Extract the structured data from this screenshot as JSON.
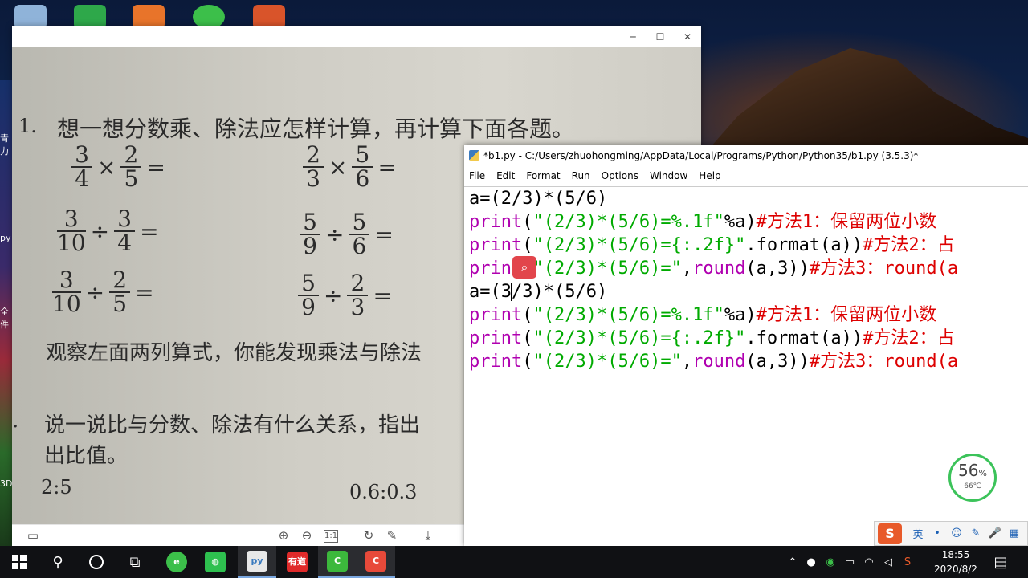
{
  "viewer": {
    "controls": {
      "minimize": "─",
      "maximize": "☐",
      "close": "✕"
    },
    "content": {
      "q1_number": "1.",
      "q1_text": "想一想分数乘、除法应怎样计算，再计算下面各题。",
      "fractions": [
        {
          "a_num": "3",
          "a_den": "4",
          "op": "×",
          "b_num": "2",
          "b_den": "5"
        },
        {
          "a_num": "2",
          "a_den": "3",
          "op": "×",
          "b_num": "5",
          "b_den": "6"
        },
        {
          "a_num": "3",
          "a_den": "10",
          "op": "÷",
          "b_num": "3",
          "b_den": "4"
        },
        {
          "a_num": "5",
          "a_den": "9",
          "op": "÷",
          "b_num": "5",
          "b_den": "6"
        },
        {
          "a_num": "3",
          "a_den": "10",
          "op": "÷",
          "b_num": "2",
          "b_den": "5"
        },
        {
          "a_num": "5",
          "a_den": "9",
          "op": "÷",
          "b_num": "2",
          "b_den": "3"
        }
      ],
      "eq": "=",
      "observe_text": "观察左面两列算式，你能发现乘法与除法",
      "q2_number": ".",
      "q2_text": "说一说比与分数、除法有什么关系，指出",
      "q2_text2": "出比值。",
      "ratio1": "2:5",
      "ratio2": "0.6:0.3"
    }
  },
  "idle": {
    "title": "*b1.py - C:/Users/zhuohongming/AppData/Local/Programs/Python/Python35/b1.py (3.5.3)*",
    "menu": [
      "File",
      "Edit",
      "Format",
      "Run",
      "Options",
      "Window",
      "Help"
    ],
    "code": {
      "l1": "a=(2/3)*(5/6)",
      "l2_kw": "print",
      "l2_open": "(",
      "l2_str": "\"(2/3)*(5/6)=%.1f\"",
      "l2_rest": "%a)",
      "l2_comment": "#方法1：保留两位小数",
      "l3_kw": "print",
      "l3_open": "(",
      "l3_str": "\"(2/3)*(5/6)={:.2f}\"",
      "l3_rest": ".format(a))",
      "l3_comment": "#方法2：占",
      "l4_kw": "print",
      "l4_open": "(",
      "l4_str": "\"(2/3)*(5/6)=\"",
      "l4_comma": ",",
      "l4_kw2": "round",
      "l4_rest": "(a,3))",
      "l4_comment": "#方法3：round(a",
      "l5_a": "a=(3",
      "l5_b": "/3)*(5/6)"
    }
  },
  "gauge": {
    "percent": "56",
    "percent_sign": "%",
    "temp": "66℃"
  },
  "ime": {
    "lang": "英",
    "items": [
      "•",
      "☺",
      "✎",
      "🎤",
      "▦"
    ]
  },
  "taskbar": {
    "youdao": "有道",
    "time": "18:55",
    "date": "2020/8/2"
  },
  "left_strip": [
    "青",
    "力",
    "py",
    "全",
    "件",
    "3D"
  ]
}
